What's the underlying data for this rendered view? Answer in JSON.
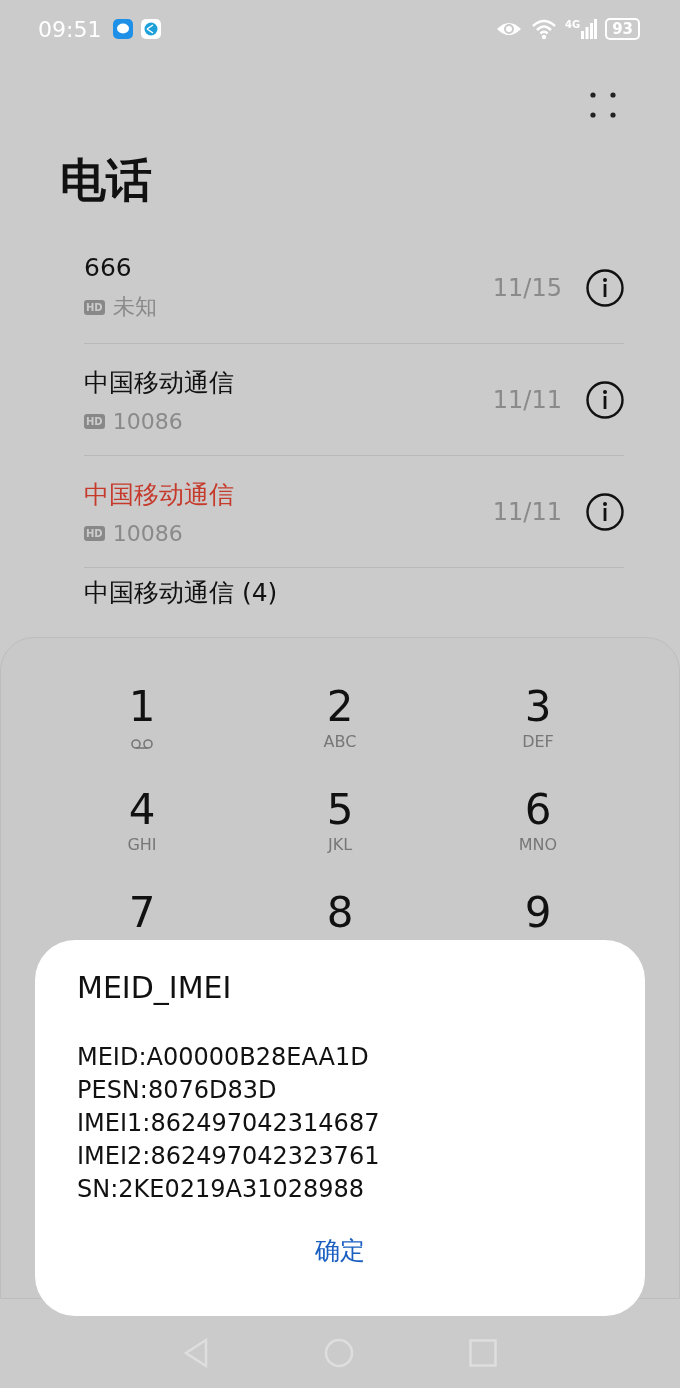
{
  "status_bar": {
    "time": "09:51",
    "network": "4G",
    "battery": "93"
  },
  "title": "电话",
  "calls": [
    {
      "name": "666",
      "missed": false,
      "badge": "HD",
      "number": "未知",
      "date": "11/15"
    },
    {
      "name": "中国移动通信",
      "missed": false,
      "badge": "HD",
      "number": "10086",
      "date": "11/11"
    },
    {
      "name": "中国移动通信",
      "missed": true,
      "badge": "HD",
      "number": "10086",
      "date": "11/11"
    },
    {
      "name": "中国移动通信 (4)",
      "missed": false
    }
  ],
  "keypad": [
    {
      "kind": "voicemail",
      "digit": "1"
    },
    {
      "kind": "letters",
      "digit": "2",
      "letters": "ABC"
    },
    {
      "kind": "letters",
      "digit": "3",
      "letters": "DEF"
    },
    {
      "kind": "letters",
      "digit": "4",
      "letters": "GHI"
    },
    {
      "kind": "letters",
      "digit": "5",
      "letters": "JKL"
    },
    {
      "kind": "letters",
      "digit": "6",
      "letters": "MNO"
    },
    {
      "kind": "digit",
      "digit": "7"
    },
    {
      "kind": "digit",
      "digit": "8"
    },
    {
      "kind": "digit",
      "digit": "9"
    }
  ],
  "dialog": {
    "title": "MEID_IMEI",
    "lines": [
      "MEID:A00000B28EAA1D",
      "PESN:8076D83D",
      "IMEI1:862497042314687",
      "IMEI2:862497042323761",
      "SN:2KE0219A31028988"
    ],
    "button": "确定"
  }
}
